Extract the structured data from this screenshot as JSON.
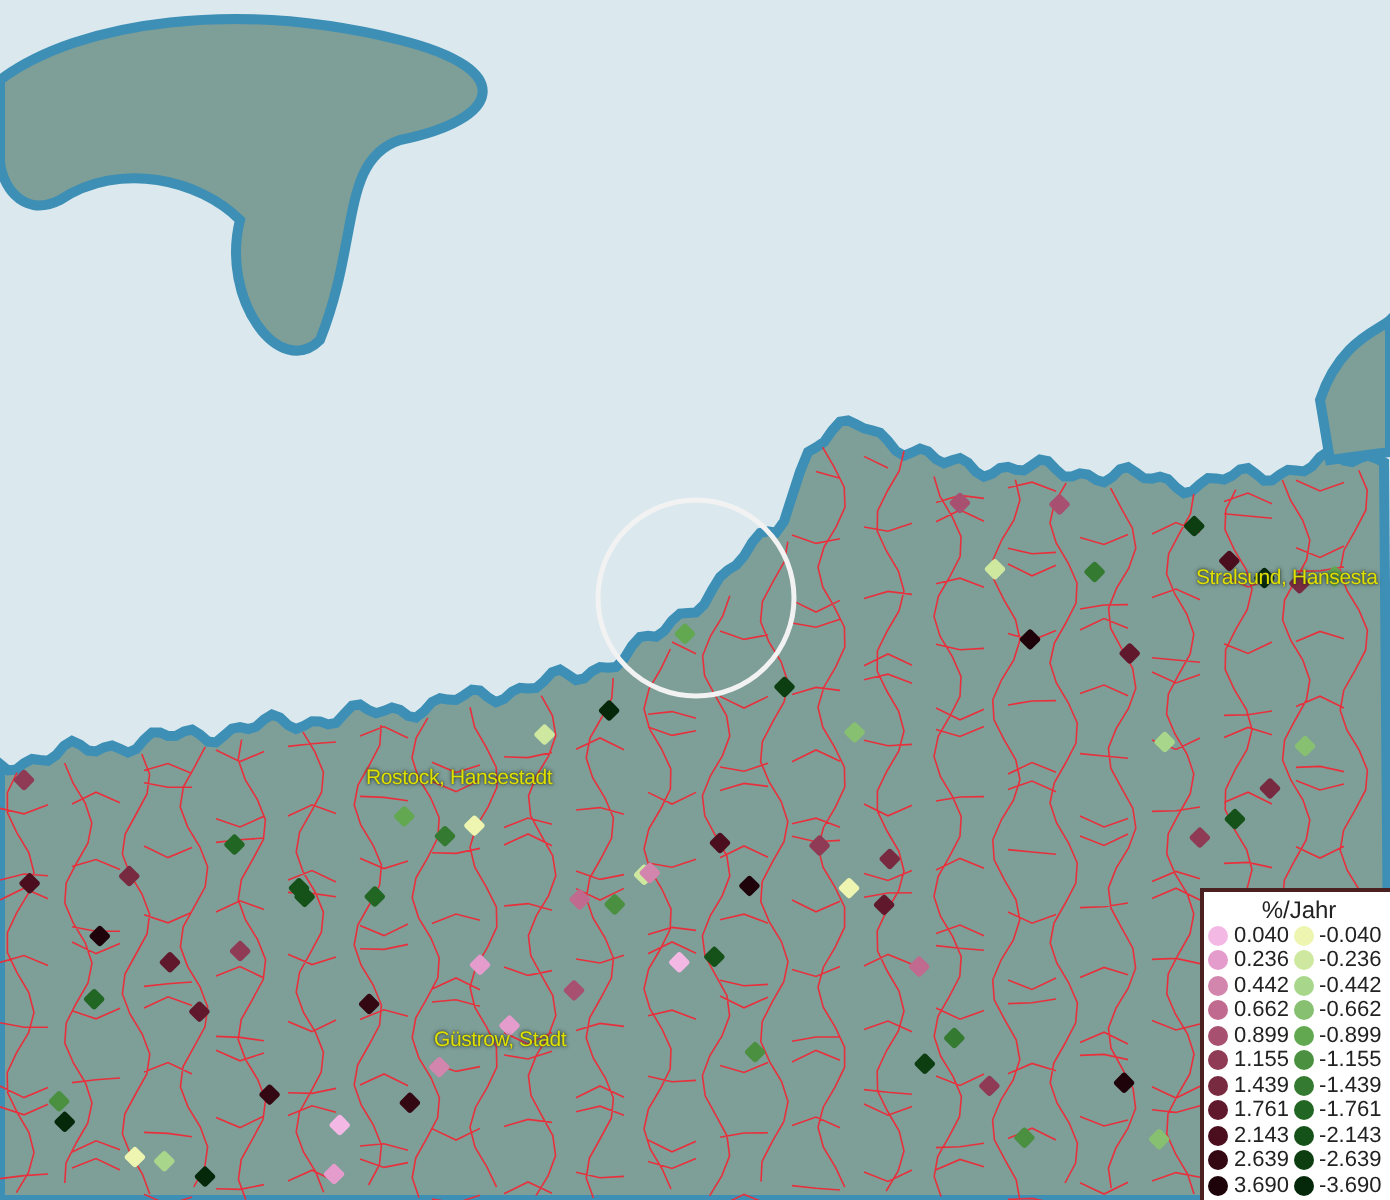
{
  "map": {
    "place_labels": [
      {
        "text": "Rostock, Hansestadt"
      },
      {
        "text": "Stralsund, Hansesta"
      },
      {
        "text": "Güstrow, Stadt"
      }
    ],
    "markers": [
      {
        "color": "#8f3b55"
      },
      {
        "color": "#15521a"
      },
      {
        "color": "#a85070"
      },
      {
        "color": "#eef5b0"
      },
      {
        "color": "#1e040a"
      },
      {
        "color": "#4a9040"
      },
      {
        "color": "#e39ccc"
      },
      {
        "color": "#05280a"
      },
      {
        "color": "#60182c"
      },
      {
        "color": "#86c070"
      },
      {
        "color": "#226624"
      },
      {
        "color": "#340812"
      },
      {
        "color": "#cfe8a0"
      },
      {
        "color": "#bf6a8e"
      },
      {
        "color": "#0c3e12"
      },
      {
        "color": "#782a40"
      },
      {
        "color": "#62a850"
      },
      {
        "color": "#f4b8e4"
      },
      {
        "color": "#347a30"
      },
      {
        "color": "#4a0e1e"
      },
      {
        "color": "#a8d68a"
      },
      {
        "color": "#d285ad"
      },
      {
        "color": "#15521a"
      },
      {
        "color": "#8f3b55"
      },
      {
        "color": "#05280a"
      },
      {
        "color": "#60182c"
      },
      {
        "color": "#eef5b0"
      },
      {
        "color": "#1e040a"
      },
      {
        "color": "#4a9040"
      },
      {
        "color": "#782a40"
      },
      {
        "color": "#226624"
      },
      {
        "color": "#e39ccc"
      },
      {
        "color": "#0c3e12"
      },
      {
        "color": "#a85070"
      },
      {
        "color": "#62a850"
      },
      {
        "color": "#340812"
      },
      {
        "color": "#cfe8a0"
      },
      {
        "color": "#8f3b55"
      },
      {
        "color": "#347a30"
      },
      {
        "color": "#4a0e1e"
      },
      {
        "color": "#15521a"
      },
      {
        "color": "#bf6a8e"
      },
      {
        "color": "#86c070"
      },
      {
        "color": "#60182c"
      },
      {
        "color": "#05280a"
      },
      {
        "color": "#f4b8e4"
      },
      {
        "color": "#4a9040"
      },
      {
        "color": "#782a40"
      },
      {
        "color": "#a8d68a"
      },
      {
        "color": "#1e040a"
      },
      {
        "color": "#226624"
      },
      {
        "color": "#d285ad"
      },
      {
        "color": "#0c3e12"
      },
      {
        "color": "#8f3b55"
      },
      {
        "color": "#eef5b0"
      },
      {
        "color": "#340812"
      },
      {
        "color": "#62a850"
      },
      {
        "color": "#a85070"
      },
      {
        "color": "#15521a"
      },
      {
        "color": "#60182c"
      },
      {
        "color": "#347a30"
      },
      {
        "color": "#4a0e1e"
      },
      {
        "color": "#cfe8a0"
      },
      {
        "color": "#782a40"
      },
      {
        "color": "#05280a"
      },
      {
        "color": "#e39ccc"
      },
      {
        "color": "#4a9040"
      },
      {
        "color": "#1e040a"
      },
      {
        "color": "#86c070"
      },
      {
        "color": "#8f3b55"
      }
    ]
  },
  "legend": {
    "title": "%/Jahr",
    "positive": [
      {
        "label": "0.040",
        "color": "#f4b8e4"
      },
      {
        "label": "0.236",
        "color": "#e39ccc"
      },
      {
        "label": "0.442",
        "color": "#d285ad"
      },
      {
        "label": "0.662",
        "color": "#bf6a8e"
      },
      {
        "label": "0.899",
        "color": "#a85070"
      },
      {
        "label": "1.155",
        "color": "#8f3b55"
      },
      {
        "label": "1.439",
        "color": "#782a40"
      },
      {
        "label": "1.761",
        "color": "#60182c"
      },
      {
        "label": "2.143",
        "color": "#4a0e1e"
      },
      {
        "label": "2.639",
        "color": "#340812"
      },
      {
        "label": "3.690",
        "color": "#1e040a"
      }
    ],
    "negative": [
      {
        "label": "-0.040",
        "color": "#eef5b0"
      },
      {
        "label": "-0.236",
        "color": "#cfe8a0"
      },
      {
        "label": "-0.442",
        "color": "#a8d68a"
      },
      {
        "label": "-0.662",
        "color": "#86c070"
      },
      {
        "label": "-0.899",
        "color": "#62a850"
      },
      {
        "label": "-1.155",
        "color": "#4a9040"
      },
      {
        "label": "-1.439",
        "color": "#347a30"
      },
      {
        "label": "-1.761",
        "color": "#226624"
      },
      {
        "label": "-2.143",
        "color": "#15521a"
      },
      {
        "label": "-2.639",
        "color": "#0c3e12"
      },
      {
        "label": "-3.690",
        "color": "#05280a"
      }
    ]
  }
}
